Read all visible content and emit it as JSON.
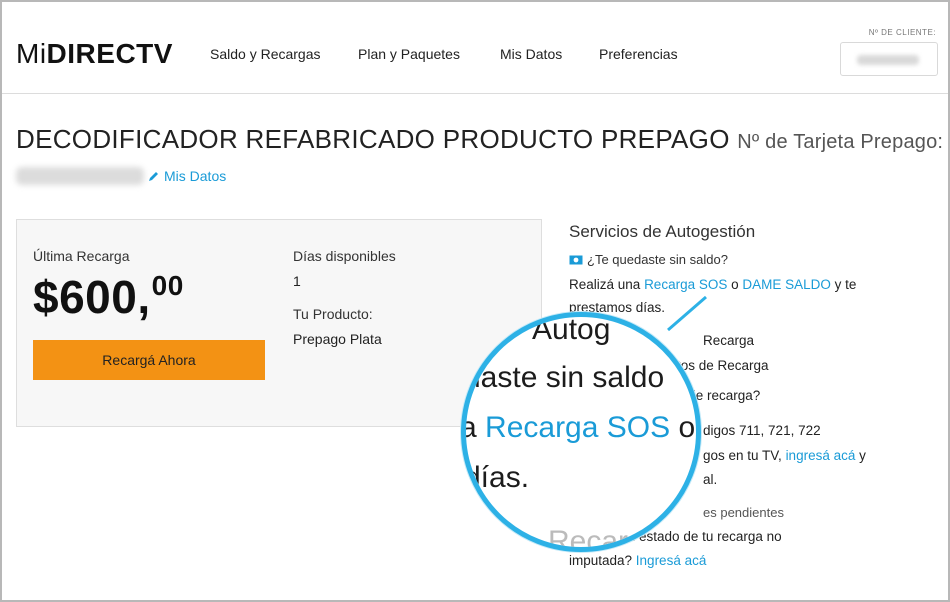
{
  "header": {
    "logo_prefix": "Mi",
    "logo_brand": "DIRECTV",
    "nav": [
      "Saldo y Recargas",
      "Plan y Paquetes",
      "Mis Datos",
      "Preferencias"
    ],
    "client_label": "Nº DE CLIENTE:"
  },
  "product": {
    "title": "DECODIFICADOR REFABRICADO PRODUCTO PREPAGO",
    "card_label": "Nº de Tarjeta Prepago:",
    "edit_link": "Mis Datos"
  },
  "panel": {
    "last_recharge_label": "Última Recarga",
    "amount_main": "$600,",
    "amount_cents": "00",
    "button_label": "Recargá Ahora",
    "days_label": "Días disponibles",
    "days_value": "1",
    "product_label": "Tu Producto:",
    "product_value": "Prepago Plata"
  },
  "services": {
    "title": "Servicios de Autogestión",
    "question": "¿Te quedaste sin saldo?",
    "line1_a": "Realizá una ",
    "link_sos": "Recarga SOS",
    "line1_b": " o ",
    "link_dame": "DAME SALDO",
    "line1_c": " y te",
    "line2": "prestamos días.",
    "item_recarga": "Recarga",
    "link_puntos": "tos de Recarga",
    "link_tipo": "a de recarga?",
    "codes": "digos 711, 721, 722",
    "tv_a": "gos en tu TV, ",
    "link_ingresa1": "ingresá acá",
    "tv_b": " y",
    "al": "al.",
    "pendientes": "es pendientes",
    "pend_line": "conocer el estado de tu recarga no",
    "imputada": "imputada? ",
    "link_ingresa2": "Ingresá acá"
  },
  "magnifier": {
    "l1": "Autog",
    "l2": "daste sin saldo",
    "l3_a": "a ",
    "l3_link": "Recarga SOS",
    "l3_b": " o",
    "l4": "días.",
    "l5": "Recarga"
  },
  "colors": {
    "accent_link": "#1a9bd7",
    "button_orange": "#f39214",
    "magnifier_border": "#2db1e6"
  }
}
